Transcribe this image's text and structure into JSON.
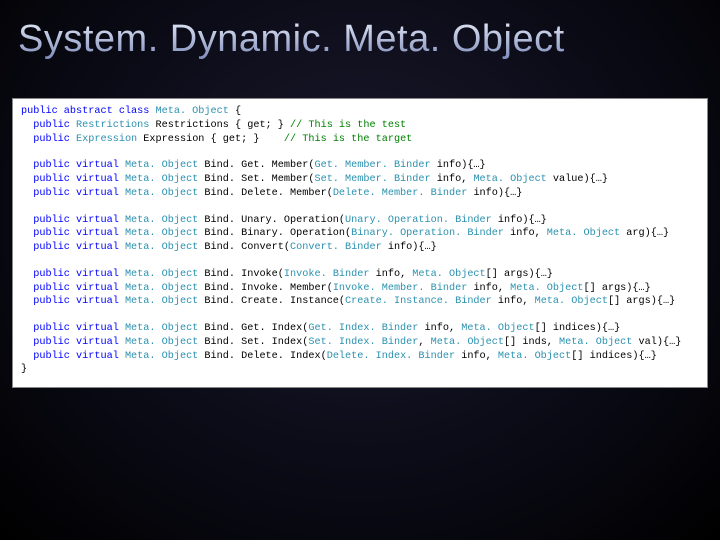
{
  "title": "System. Dynamic. Meta. Object",
  "code": {
    "l1a": "public abstract class ",
    "l1b": "Meta. Object ",
    "l1c": "{",
    "l2a": "  public ",
    "l2b": "Restrictions ",
    "l2c": "Restrictions { get; } ",
    "l2d": "// This is the test",
    "l3a": "  public ",
    "l3b": "Expression ",
    "l3c": "Expression { get; }    ",
    "l3d": "// This is the target",
    "l4a": "  public virtual ",
    "l4b": "Meta. Object ",
    "l4c": "Bind. Get. Member(",
    "l4d": "Get. Member. Binder ",
    "l4e": "info){…}",
    "l5a": "  public virtual ",
    "l5b": "Meta. Object ",
    "l5c": "Bind. Set. Member(",
    "l5d": "Set. Member. Binder ",
    "l5e": "info, ",
    "l5f": "Meta. Object ",
    "l5g": "value){…}",
    "l6a": "  public virtual ",
    "l6b": "Meta. Object ",
    "l6c": "Bind. Delete. Member(",
    "l6d": "Delete. Member. Binder ",
    "l6e": "info){…}",
    "l7a": "  public virtual ",
    "l7b": "Meta. Object ",
    "l7c": "Bind. Unary. Operation(",
    "l7d": "Unary. Operation. Binder ",
    "l7e": "info){…}",
    "l8a": "  public virtual ",
    "l8b": "Meta. Object ",
    "l8c": "Bind. Binary. Operation(",
    "l8d": "Binary. Operation. Binder ",
    "l8e": "info, ",
    "l8f": "Meta. Object ",
    "l8g": "arg){…}",
    "l9a": "  public virtual ",
    "l9b": "Meta. Object ",
    "l9c": "Bind. Convert(",
    "l9d": "Convert. Binder ",
    "l9e": "info){…}",
    "l10a": "  public virtual ",
    "l10b": "Meta. Object ",
    "l10c": "Bind. Invoke(",
    "l10d": "Invoke. Binder ",
    "l10e": "info, ",
    "l10f": "Meta. Object",
    "l10g": "[] args){…}",
    "l11a": "  public virtual ",
    "l11b": "Meta. Object ",
    "l11c": "Bind. Invoke. Member(",
    "l11d": "Invoke. Member. Binder ",
    "l11e": "info, ",
    "l11f": "Meta. Object",
    "l11g": "[] args){…}",
    "l12a": "  public virtual ",
    "l12b": "Meta. Object ",
    "l12c": "Bind. Create. Instance(",
    "l12d": "Create. Instance. Binder ",
    "l12e": "info, ",
    "l12f": "Meta. Object",
    "l12g": "[] args){…}",
    "l13a": "  public virtual ",
    "l13b": "Meta. Object ",
    "l13c": "Bind. Get. Index(",
    "l13d": "Get. Index. Binder ",
    "l13e": "info, ",
    "l13f": "Meta. Object",
    "l13g": "[] indices){…}",
    "l14a": "  public virtual ",
    "l14b": "Meta. Object ",
    "l14c": "Bind. Set. Index(",
    "l14d": "Set. Index. Binder",
    "l14e": ", ",
    "l14f": "Meta. Object",
    "l14g": "[] inds, ",
    "l14h": "Meta. Object ",
    "l14i": "val){…}",
    "l15a": "  public virtual ",
    "l15b": "Meta. Object ",
    "l15c": "Bind. Delete. Index(",
    "l15d": "Delete. Index. Binder ",
    "l15e": "info, ",
    "l15f": "Meta. Object",
    "l15g": "[] indices){…}",
    "l16": "}"
  }
}
